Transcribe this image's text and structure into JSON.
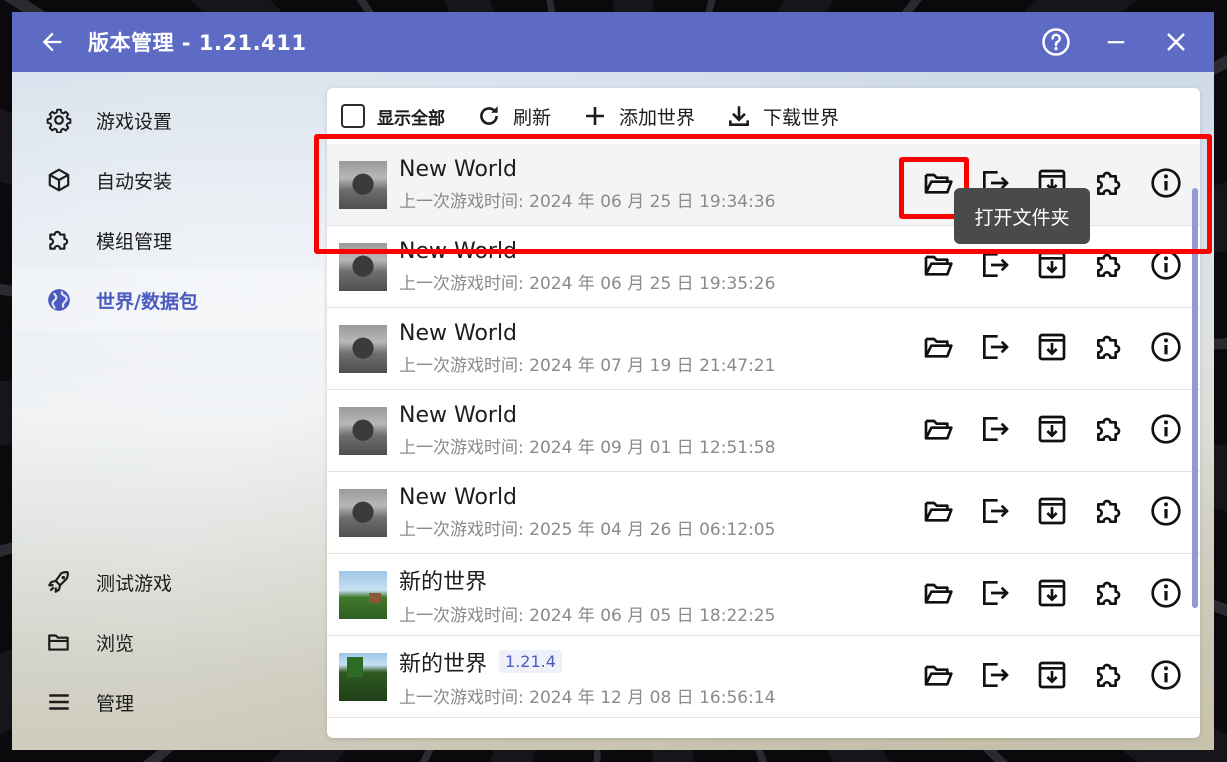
{
  "window": {
    "title": "版本管理 - 1.21.411"
  },
  "titlebar": {
    "icons": [
      "back-arrow-icon",
      "help-icon",
      "minimize-icon",
      "close-icon"
    ]
  },
  "sidebar": {
    "items": [
      {
        "label": "游戏设置",
        "icon": "gear-icon"
      },
      {
        "label": "自动安装",
        "icon": "cube-icon"
      },
      {
        "label": "模组管理",
        "icon": "puzzle-icon"
      },
      {
        "label": "世界/数据包",
        "icon": "globe-icon",
        "active": true
      }
    ],
    "bottom_items": [
      {
        "label": "测试游戏",
        "icon": "rocket-icon"
      },
      {
        "label": "浏览",
        "icon": "folder-icon"
      },
      {
        "label": "管理",
        "icon": "menu-icon"
      }
    ]
  },
  "toolbar": {
    "show_all": "显示全部",
    "refresh": "刷新",
    "add_world": "添加世界",
    "download_world": "下载世界"
  },
  "worlds": [
    {
      "name": "New World",
      "last_played": "上一次游戏时间: 2024 年 06 月 25 日 19:34:36",
      "version": "",
      "thumb": "gray"
    },
    {
      "name": "New World",
      "last_played": "上一次游戏时间: 2024 年 06 月 25 日 19:35:26",
      "version": "",
      "thumb": "gray"
    },
    {
      "name": "New World",
      "last_played": "上一次游戏时间: 2024 年 07 月 19 日 21:47:21",
      "version": "",
      "thumb": "gray"
    },
    {
      "name": "New World",
      "last_played": "上一次游戏时间: 2024 年 09 月 01 日 12:51:58",
      "version": "",
      "thumb": "gray"
    },
    {
      "name": "New World",
      "last_played": "上一次游戏时间: 2025 年 04 月 26 日 06:12:05",
      "version": "",
      "thumb": "gray"
    },
    {
      "name": "新的世界",
      "last_played": "上一次游戏时间: 2024 年 06 月 05 日 18:22:25",
      "version": "",
      "thumb": "green"
    },
    {
      "name": "新的世界",
      "last_played": "上一次游戏时间: 2024 年 12 月 08 日 16:56:14",
      "version": "1.21.4",
      "thumb": "forest"
    }
  ],
  "row_actions": [
    "open-folder-icon",
    "export-icon",
    "backup-icon",
    "datapack-icon",
    "info-icon"
  ],
  "tooltip": {
    "text": "打开文件夹"
  },
  "colors": {
    "accent": "#5d6bc4",
    "highlight": "#ff0000"
  }
}
